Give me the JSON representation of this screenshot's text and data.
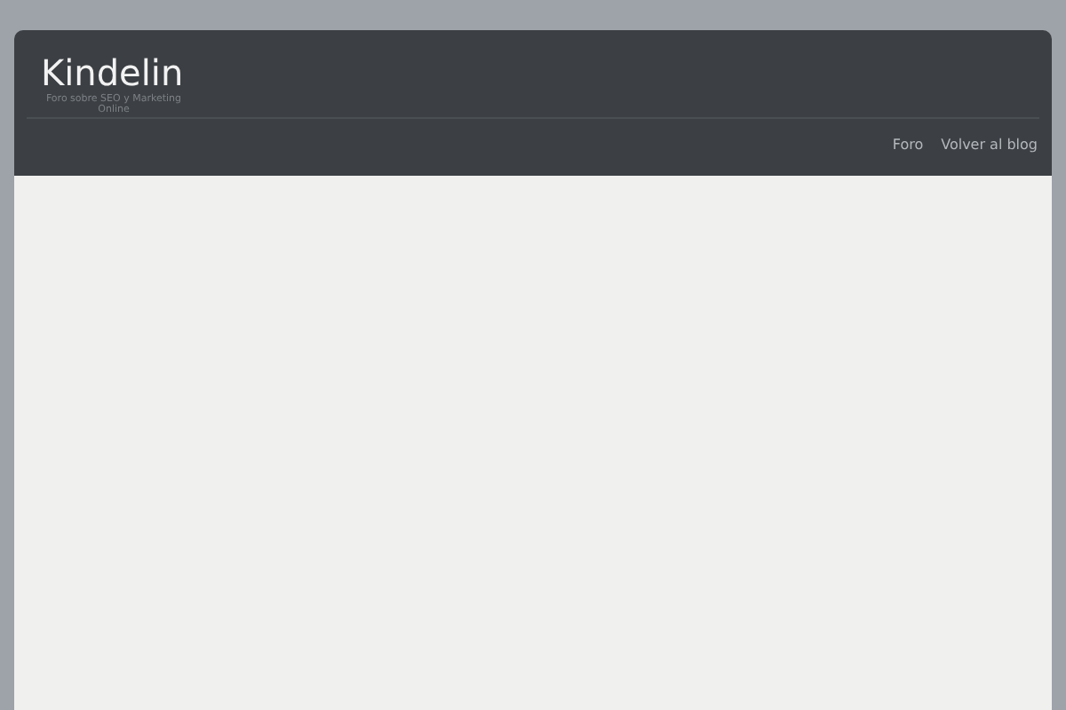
{
  "site": {
    "title": "Kindelin",
    "tagline": "Foro sobre SEO y Marketing Online"
  },
  "nav": [
    {
      "label": "Foro"
    },
    {
      "label": "Volver al blog"
    }
  ]
}
